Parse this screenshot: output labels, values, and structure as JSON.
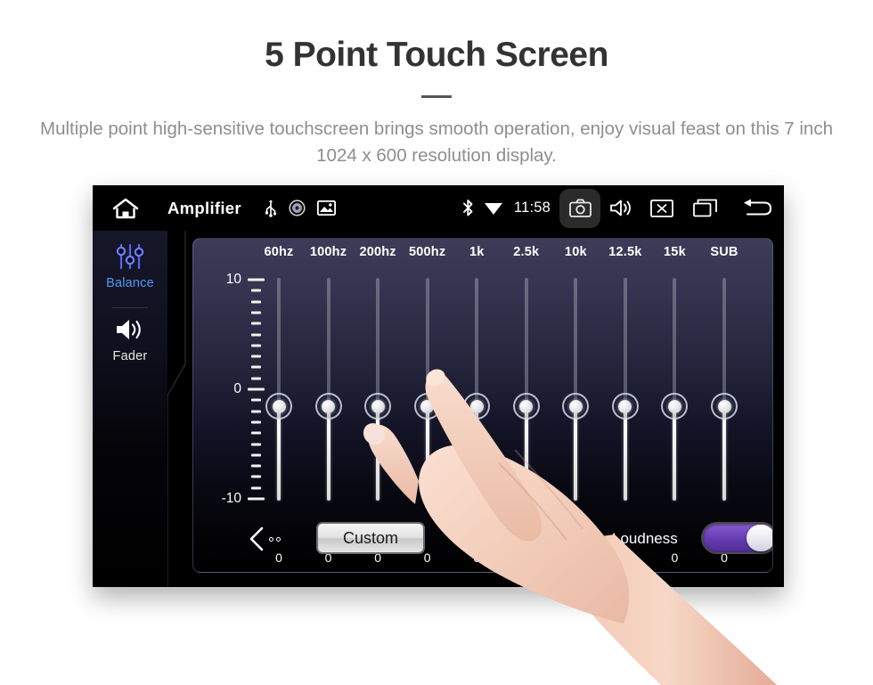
{
  "promo": {
    "title": "5 Point Touch Screen",
    "subtitle": "Multiple point high-sensitive touchscreen brings smooth operation, enjoy visual feast on this 7 inch 1024 x 600 resolution display."
  },
  "statusbar": {
    "home_icon": "home-icon",
    "app_title": "Amplifier",
    "mid_icons": [
      "usb-icon",
      "disc-icon",
      "gallery-icon"
    ],
    "bluetooth_icon": "bluetooth-icon",
    "wifi_icon": "wifi-icon",
    "time": "11:58",
    "camera_icon": "camera-icon",
    "volume_icon": "volume-icon",
    "close_icon": "close-box-icon",
    "recents_icon": "recent-apps-icon",
    "back_icon": "back-arrow-icon"
  },
  "sidebar": {
    "items": [
      {
        "label": "Balance",
        "icon": "equalizer-sliders-icon",
        "active": true
      },
      {
        "label": "Fader",
        "icon": "speaker-icon",
        "active": false
      }
    ]
  },
  "equalizer": {
    "scale_labels": [
      "10",
      "0",
      "-10"
    ],
    "bands": [
      {
        "label": "60hz",
        "value": "0"
      },
      {
        "label": "100hz",
        "value": "0"
      },
      {
        "label": "200hz",
        "value": "0"
      },
      {
        "label": "500hz",
        "value": "0"
      },
      {
        "label": "1k",
        "value": "0"
      },
      {
        "label": "2.5k",
        "value": "0"
      },
      {
        "label": "10k",
        "value": "0"
      },
      {
        "label": "12.5k",
        "value": "0"
      },
      {
        "label": "15k",
        "value": "0"
      },
      {
        "label": "SUB",
        "value": "0"
      }
    ]
  },
  "controls": {
    "prev_icon": "chevron-left-icon",
    "next_icon": "chevron-right-icon",
    "preset_label": "Custom",
    "loudness_label": "Loudness",
    "loudness_on": true,
    "accent_purple": "#6b3fb8"
  },
  "colors": {
    "accent_blue": "#4e9bf0",
    "panel_top": "#3c3c58",
    "panel_bottom": "#000000",
    "title_gray": "#333333",
    "subtitle_gray": "#8e8e8e"
  }
}
